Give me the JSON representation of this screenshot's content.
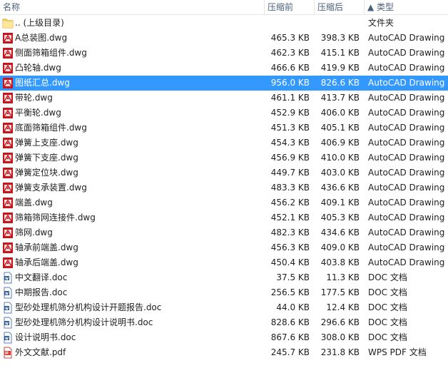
{
  "header": {
    "name": "名称",
    "compressed": "压缩前",
    "original": "压缩后",
    "type": "▲ 类型"
  },
  "rows": [
    {
      "icon": "folder-icon",
      "name": ".. (上级目录)",
      "comp": "",
      "orig": "",
      "type": "文件夹"
    },
    {
      "icon": "dwg-file-icon",
      "name": "A总装图.dwg",
      "comp": "465.3 KB",
      "orig": "398.3 KB",
      "type": "AutoCAD Drawing"
    },
    {
      "icon": "dwg-file-icon",
      "name": "侧面筛箱组件.dwg",
      "comp": "462.3 KB",
      "orig": "415.1 KB",
      "type": "AutoCAD Drawing"
    },
    {
      "icon": "dwg-file-icon",
      "name": "凸轮轴.dwg",
      "comp": "466.6 KB",
      "orig": "419.9 KB",
      "type": "AutoCAD Drawing"
    },
    {
      "icon": "dwg-file-icon",
      "name": "图纸汇总.dwg",
      "comp": "956.0 KB",
      "orig": "826.6 KB",
      "type": "AutoCAD Drawing",
      "selected": true
    },
    {
      "icon": "dwg-file-icon",
      "name": "带轮.dwg",
      "comp": "461.1 KB",
      "orig": "413.7 KB",
      "type": "AutoCAD Drawing"
    },
    {
      "icon": "dwg-file-icon",
      "name": "平衡轮.dwg",
      "comp": "452.9 KB",
      "orig": "406.0 KB",
      "type": "AutoCAD Drawing"
    },
    {
      "icon": "dwg-file-icon",
      "name": "底面筛箱组件.dwg",
      "comp": "451.3 KB",
      "orig": "405.1 KB",
      "type": "AutoCAD Drawing"
    },
    {
      "icon": "dwg-file-icon",
      "name": "弹簧上支座.dwg",
      "comp": "454.3 KB",
      "orig": "406.9 KB",
      "type": "AutoCAD Drawing"
    },
    {
      "icon": "dwg-file-icon",
      "name": "弹簧下支座.dwg",
      "comp": "456.9 KB",
      "orig": "410.0 KB",
      "type": "AutoCAD Drawing"
    },
    {
      "icon": "dwg-file-icon",
      "name": "弹簧定位块.dwg",
      "comp": "449.7 KB",
      "orig": "403.0 KB",
      "type": "AutoCAD Drawing"
    },
    {
      "icon": "dwg-file-icon",
      "name": "弹簧支承装置.dwg",
      "comp": "483.3 KB",
      "orig": "436.6 KB",
      "type": "AutoCAD Drawing"
    },
    {
      "icon": "dwg-file-icon",
      "name": "端盖.dwg",
      "comp": "456.2 KB",
      "orig": "409.1 KB",
      "type": "AutoCAD Drawing"
    },
    {
      "icon": "dwg-file-icon",
      "name": "筛箱筛网连接件.dwg",
      "comp": "452.1 KB",
      "orig": "405.3 KB",
      "type": "AutoCAD Drawing"
    },
    {
      "icon": "dwg-file-icon",
      "name": "筛网.dwg",
      "comp": "482.3 KB",
      "orig": "434.6 KB",
      "type": "AutoCAD Drawing"
    },
    {
      "icon": "dwg-file-icon",
      "name": "轴承前端盖.dwg",
      "comp": "456.3 KB",
      "orig": "409.0 KB",
      "type": "AutoCAD Drawing"
    },
    {
      "icon": "dwg-file-icon",
      "name": "轴承后端盖.dwg",
      "comp": "450.4 KB",
      "orig": "403.8 KB",
      "type": "AutoCAD Drawing"
    },
    {
      "icon": "doc-file-icon",
      "name": "中文翻译.doc",
      "comp": "37.5 KB",
      "orig": "11.3 KB",
      "type": "DOC 文档"
    },
    {
      "icon": "doc-file-icon",
      "name": "中期报告.doc",
      "comp": "256.5 KB",
      "orig": "177.5 KB",
      "type": "DOC 文档"
    },
    {
      "icon": "doc-file-icon",
      "name": "型砂处理机筛分机构设计开题报告.doc",
      "comp": "44.0 KB",
      "orig": "12.4 KB",
      "type": "DOC 文档"
    },
    {
      "icon": "doc-file-icon",
      "name": "型砂处理机筛分机构设计说明书.doc",
      "comp": "828.6 KB",
      "orig": "296.6 KB",
      "type": "DOC 文档"
    },
    {
      "icon": "doc-file-icon",
      "name": "设计说明书.doc",
      "comp": "867.6 KB",
      "orig": "308.0 KB",
      "type": "DOC 文档"
    },
    {
      "icon": "pdf-file-icon",
      "name": "外文文献.pdf",
      "comp": "245.7 KB",
      "orig": "231.8 KB",
      "type": "WPS PDF 文档"
    }
  ]
}
